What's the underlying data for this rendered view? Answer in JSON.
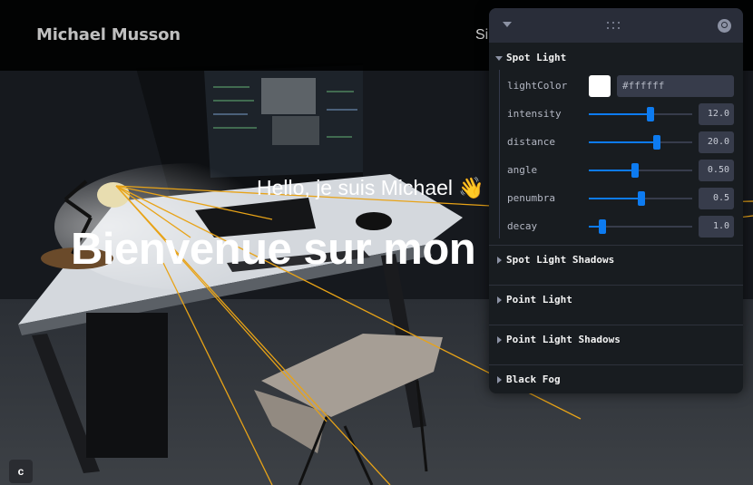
{
  "header": {
    "brand": "Michael Musson",
    "nav_partial": "Si"
  },
  "hero": {
    "greeting": "Hello, je suis Michael 👋",
    "title": "Bienvenue sur mon p"
  },
  "corner_button": {
    "label": "c"
  },
  "gui": {
    "spot_light": {
      "title": "Spot Light",
      "light_color": {
        "label": "lightColor",
        "value": "#ffffff"
      },
      "sliders": [
        {
          "label": "intensity",
          "value": "12.0",
          "fraction": 0.6
        },
        {
          "label": "distance",
          "value": "20.0",
          "fraction": 0.66
        },
        {
          "label": "angle",
          "value": "0.50",
          "fraction": 0.45
        },
        {
          "label": "penumbra",
          "value": "0.5",
          "fraction": 0.51
        },
        {
          "label": "decay",
          "value": "1.0",
          "fraction": 0.13
        }
      ]
    },
    "sections": [
      {
        "title": "Spot Light Shadows"
      },
      {
        "title": "Point Light"
      },
      {
        "title": "Point Light Shadows"
      },
      {
        "title": "Black Fog"
      }
    ]
  },
  "colors": {
    "accent": "#0d7bf0",
    "helper_lines": "#e8a317",
    "panel_bg": "#181c20",
    "panel_header": "#292d39"
  }
}
